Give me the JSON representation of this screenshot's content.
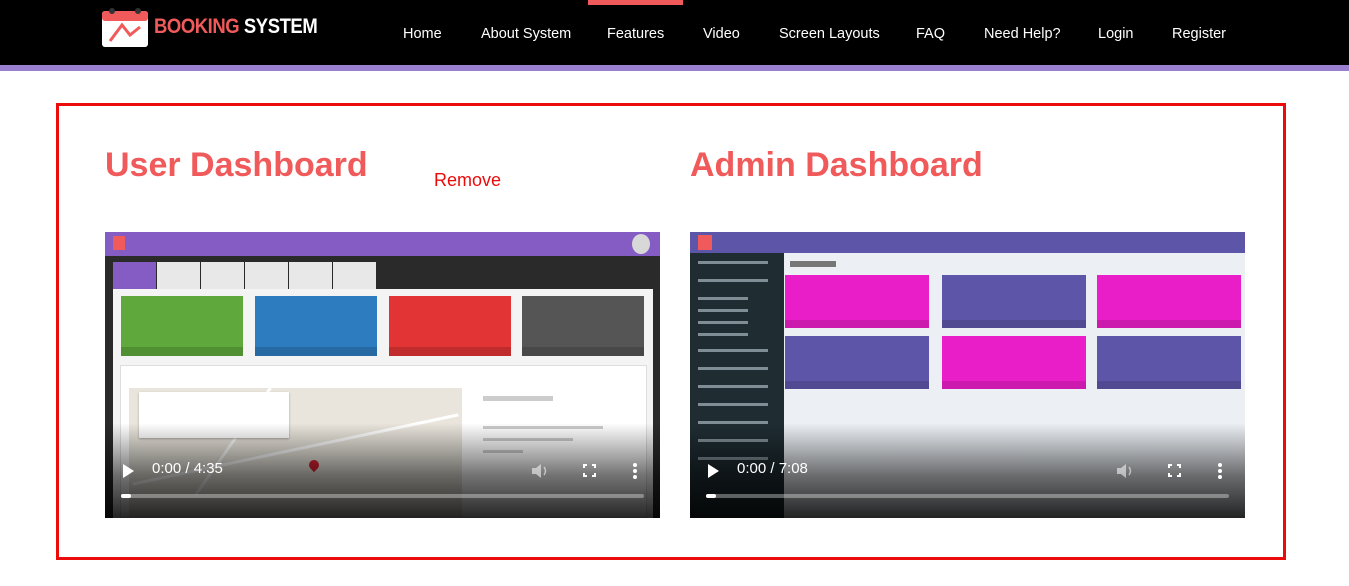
{
  "navbar": {
    "logo": {
      "word1": "BOOKING",
      "word2": "SYSTEM"
    },
    "links": [
      "Home",
      "About System",
      "Features",
      "Video",
      "Screen Layouts",
      "FAQ",
      "Need Help?",
      "Login",
      "Register"
    ],
    "active": "Features"
  },
  "section": {
    "user": {
      "title": "User Dashboard",
      "remove_label": "Remove",
      "video": {
        "time": "0:00 / 4:35",
        "progress": 0.0
      }
    },
    "admin": {
      "title": "Admin Dashboard",
      "video": {
        "time": "0:00 / 7:08",
        "progress": 0.0
      }
    }
  },
  "colors": {
    "accent": "#f05a5a",
    "frame": "#ec0b0b",
    "navbar": "#000000",
    "stripe": "#9b7fd0"
  }
}
